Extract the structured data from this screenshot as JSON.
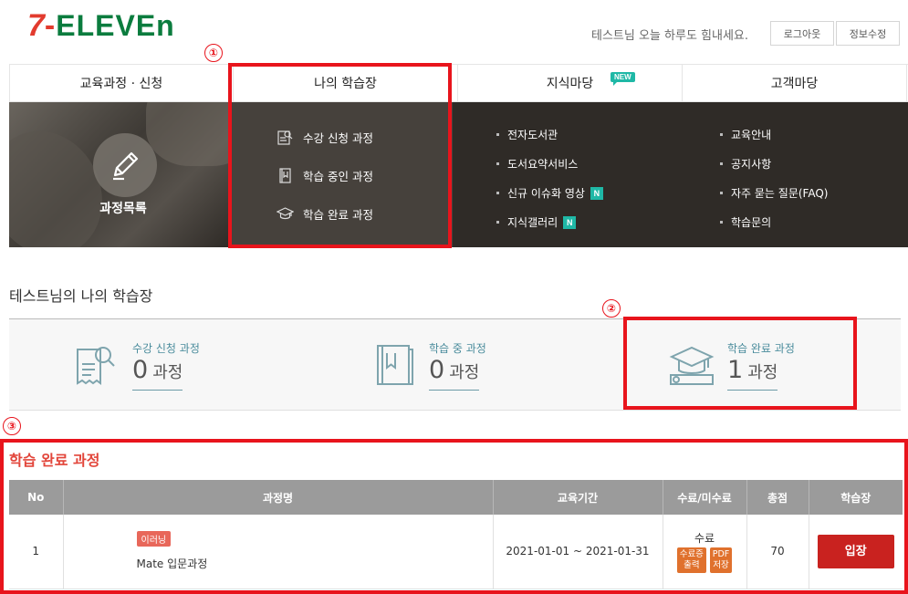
{
  "header": {
    "logo": {
      "part1": "7",
      "part2": "-",
      "part3": "ELEVEn"
    },
    "greeting": "테스트님 오늘 하루도 힘내세요.",
    "logout_label": "로그아웃",
    "profile_label": "정보수정"
  },
  "nav": {
    "items": [
      {
        "label": "교육과정 · 신청"
      },
      {
        "label": "나의 학습장"
      },
      {
        "label": "지식마당",
        "badge": "NEW"
      },
      {
        "label": "고객마당"
      }
    ]
  },
  "mega": {
    "photo_label": "과정목록",
    "my_study": [
      {
        "label": "수강 신청 과정",
        "icon": "application-form-icon"
      },
      {
        "label": "학습 중인 과정",
        "icon": "book-icon"
      },
      {
        "label": "학습 완료 과정",
        "icon": "graduation-cap-icon"
      }
    ],
    "knowledge": [
      {
        "label": "전자도서관"
      },
      {
        "label": "도서요약서비스"
      },
      {
        "label": "신규 이슈화 영상",
        "badge": "N"
      },
      {
        "label": "지식갤러리",
        "badge": "N"
      }
    ],
    "customer": [
      {
        "label": "교육안내"
      },
      {
        "label": "공지사항"
      },
      {
        "label": "자주 묻는 질문(FAQ)"
      },
      {
        "label": "학습문의"
      }
    ]
  },
  "annotations": {
    "one": "①",
    "two": "②",
    "three": "③"
  },
  "my_page": {
    "title": "테스트님의 나의 학습장",
    "stats": [
      {
        "label": "수강 신청 과정",
        "count": "0",
        "unit": "과정",
        "icon": "application-form-icon"
      },
      {
        "label": "학습 중 과정",
        "count": "0",
        "unit": "과정",
        "icon": "book-icon"
      },
      {
        "label": "학습 완료 과정",
        "count": "1",
        "unit": "과정",
        "icon": "graduation-cap-icon"
      }
    ]
  },
  "completed": {
    "title": "학습 완료 과정",
    "columns": [
      "No",
      "과정명",
      "교육기간",
      "수료/미수료",
      "총점",
      "학습장"
    ],
    "rows": [
      {
        "no": "1",
        "type_badge": "이러닝",
        "course_name": "Mate 입문과정",
        "period": "2021-01-01 ~ 2021-01-31",
        "status": "수료",
        "cert_btn_line1": "수료증",
        "cert_btn_line2": "출력",
        "pdf_btn_line1": "PDF",
        "pdf_btn_line2": "저장",
        "score": "70",
        "enter_label": "입장"
      }
    ]
  },
  "colors": {
    "accent_red": "#e8141c",
    "dark_menu": "#2f2b27",
    "teal_badge": "#1fb8a6",
    "enter_button": "#c9221f",
    "table_header": "#9b9b9b"
  }
}
